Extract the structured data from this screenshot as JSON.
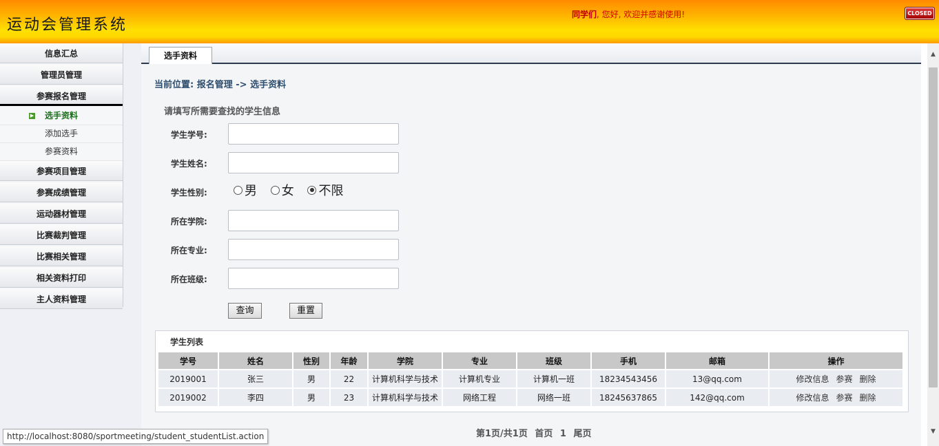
{
  "header": {
    "app_title": "运动会管理系统",
    "welcome_name": "同学们",
    "welcome_text": ", 您好, 欢迎并感谢使用!",
    "close_label": "CLOSED"
  },
  "sidebar": {
    "items": [
      {
        "label": "信息汇总"
      },
      {
        "label": "管理员管理"
      },
      {
        "label": "参赛报名管理"
      },
      {
        "label": "参赛项目管理"
      },
      {
        "label": "参赛成绩管理"
      },
      {
        "label": "运动器材管理"
      },
      {
        "label": "比赛裁判管理"
      },
      {
        "label": "比赛相关管理"
      },
      {
        "label": "相关资料打印"
      },
      {
        "label": "主人资料管理"
      }
    ],
    "sub_items": [
      {
        "label": "选手资料"
      },
      {
        "label": "添加选手"
      },
      {
        "label": "参赛资料"
      }
    ]
  },
  "tab": {
    "label": "选手资料"
  },
  "breadcrumb": "当前位置: 报名管理 -> 选手资料",
  "form": {
    "caption": "请填写所需要查找的学生信息",
    "student_id_label": "学生学号:",
    "student_name_label": "学生姓名:",
    "gender_label": "学生性别:",
    "gender_options": [
      "男",
      "女",
      "不限"
    ],
    "gender_selected": "不限",
    "college_label": "所在学院:",
    "major_label": "所在专业:",
    "class_label": "所在班级:",
    "query_button": "查询",
    "reset_button": "重置"
  },
  "student_list": {
    "title": "学生列表",
    "columns": [
      "学号",
      "姓名",
      "性别",
      "年龄",
      "学院",
      "专业",
      "班级",
      "手机",
      "邮箱",
      "操作"
    ],
    "rows": [
      {
        "id": "2019001",
        "name": "张三",
        "gender": "男",
        "age": "22",
        "college": "计算机科学与技术",
        "major": "计算机专业",
        "class": "计算机一班",
        "phone": "18234543456",
        "email": "13@qq.com",
        "edit": "修改信息",
        "enroll": "参赛",
        "delete": "删除"
      },
      {
        "id": "2019002",
        "name": "李四",
        "gender": "男",
        "age": "23",
        "college": "计算机科学与技术",
        "major": "网络工程",
        "class": "网络一班",
        "phone": "18245637865",
        "email": "142@qq.com",
        "edit": "修改信息",
        "enroll": "参赛",
        "delete": "删除"
      }
    ]
  },
  "pager": {
    "page_info": "第1页/共1页",
    "first": "首页",
    "current": "1",
    "last": "尾页"
  },
  "status_url": "http://localhost:8080/sportmeeting/student_studentList.action"
}
